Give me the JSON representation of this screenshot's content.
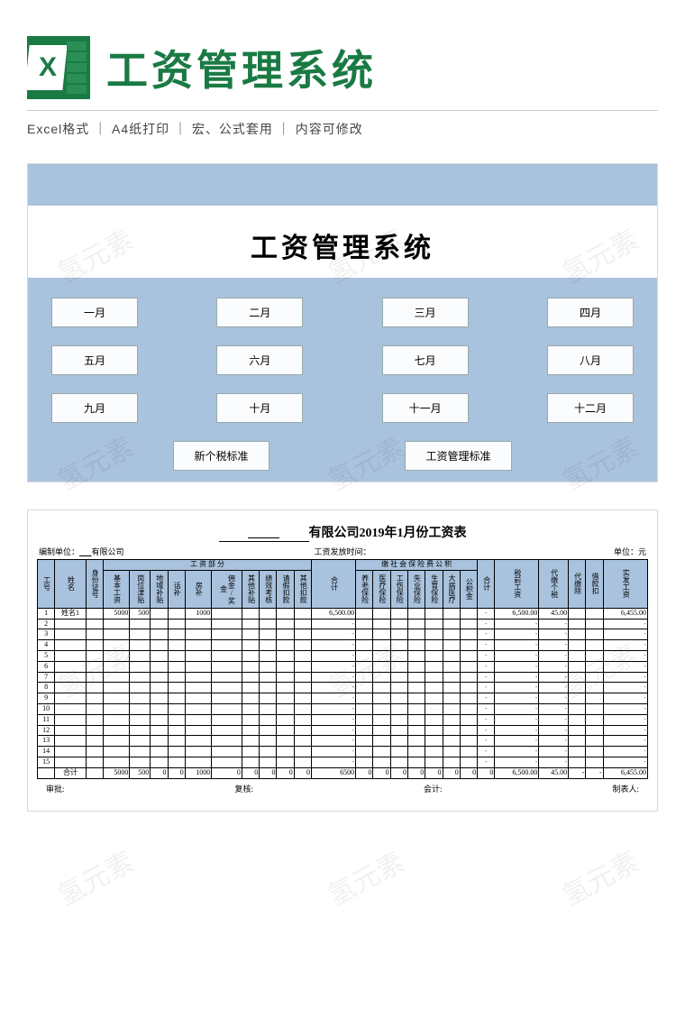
{
  "header": {
    "title": "工资管理系统"
  },
  "meta": "Excel格式 ｜ A4纸打印 ｜ 宏、公式套用 ｜ 内容可修改",
  "panel1": {
    "title": "工资管理系统",
    "months": [
      "一月",
      "二月",
      "三月",
      "四月",
      "五月",
      "六月",
      "七月",
      "八月",
      "九月",
      "十月",
      "十一月",
      "十二月"
    ],
    "std1": "新个税标准",
    "std2": "工资管理标准"
  },
  "panel2": {
    "title_suffix": "有限公司2019年1月份工资表",
    "meta_left_label": "编制单位：",
    "meta_left_value": "有限公司",
    "meta_mid": "工资发放时间：",
    "meta_right": "单位：元",
    "group_salary": "工  资  部  分",
    "group_ins": "缴 社 会 保 险 费 公 积",
    "cols_fixed": [
      "工号",
      "姓名",
      "身份证号"
    ],
    "cols_salary": [
      "基本工资",
      "岗位津贴",
      "地域补贴",
      "话补",
      "房补",
      "佣金/奖金",
      "其他补贴",
      "绩效考核",
      "请假扣款",
      "其他扣款"
    ],
    "col_heji": "合计",
    "cols_ins": [
      "养老保险",
      "医疗保险",
      "工伤保险",
      "失业保险",
      "生育保险",
      "大病医疗",
      "公积金"
    ],
    "cols_tail": [
      "税前工资",
      "代缴个税",
      "代缴除",
      "借款扣",
      "实发工资"
    ],
    "rows": [
      {
        "id": "1",
        "name": "姓名1",
        "v": [
          "5000",
          "500",
          "",
          "",
          "1000",
          "",
          "",
          "",
          "",
          ""
        ],
        "heji": "6,500.00",
        "ins": [
          "",
          "",
          "",
          "",
          "",
          "",
          ""
        ],
        "tail": [
          "6,500.00",
          "45.00",
          "",
          "",
          "6,455.00"
        ]
      },
      {
        "id": "2",
        "name": "",
        "v": [
          "",
          "",
          "",
          "",
          "",
          "",
          "",
          "",
          "",
          ""
        ],
        "heji": "-",
        "ins": [
          "",
          "",
          "",
          "",
          "",
          "",
          ""
        ],
        "tail": [
          "-",
          "-",
          "",
          "",
          "-"
        ]
      },
      {
        "id": "3",
        "name": "",
        "v": [
          "",
          "",
          "",
          "",
          "",
          "",
          "",
          "",
          "",
          ""
        ],
        "heji": "-",
        "ins": [
          "",
          "",
          "",
          "",
          "",
          "",
          ""
        ],
        "tail": [
          "-",
          "-",
          "",
          "",
          "-"
        ]
      },
      {
        "id": "4",
        "name": "",
        "v": [
          "",
          "",
          "",
          "",
          "",
          "",
          "",
          "",
          "",
          ""
        ],
        "heji": "-",
        "ins": [
          "",
          "",
          "",
          "",
          "",
          "",
          ""
        ],
        "tail": [
          "-",
          "-",
          "",
          "",
          "-"
        ]
      },
      {
        "id": "5",
        "name": "",
        "v": [
          "",
          "",
          "",
          "",
          "",
          "",
          "",
          "",
          "",
          ""
        ],
        "heji": "-",
        "ins": [
          "",
          "",
          "",
          "",
          "",
          "",
          ""
        ],
        "tail": [
          "-",
          "-",
          "",
          "",
          "-"
        ]
      },
      {
        "id": "6",
        "name": "",
        "v": [
          "",
          "",
          "",
          "",
          "",
          "",
          "",
          "",
          "",
          ""
        ],
        "heji": "-",
        "ins": [
          "",
          "",
          "",
          "",
          "",
          "",
          ""
        ],
        "tail": [
          "-",
          "-",
          "",
          "",
          "-"
        ]
      },
      {
        "id": "7",
        "name": "",
        "v": [
          "",
          "",
          "",
          "",
          "",
          "",
          "",
          "",
          "",
          ""
        ],
        "heji": "-",
        "ins": [
          "",
          "",
          "",
          "",
          "",
          "",
          ""
        ],
        "tail": [
          "-",
          "-",
          "",
          "",
          "-"
        ]
      },
      {
        "id": "8",
        "name": "",
        "v": [
          "",
          "",
          "",
          "",
          "",
          "",
          "",
          "",
          "",
          ""
        ],
        "heji": "-",
        "ins": [
          "",
          "",
          "",
          "",
          "",
          "",
          ""
        ],
        "tail": [
          "-",
          "-",
          "",
          "",
          "-"
        ]
      },
      {
        "id": "9",
        "name": "",
        "v": [
          "",
          "",
          "",
          "",
          "",
          "",
          "",
          "",
          "",
          ""
        ],
        "heji": "-",
        "ins": [
          "",
          "",
          "",
          "",
          "",
          "",
          ""
        ],
        "tail": [
          "-",
          "-",
          "",
          "",
          "-"
        ]
      },
      {
        "id": "10",
        "name": "",
        "v": [
          "",
          "",
          "",
          "",
          "",
          "",
          "",
          "",
          "",
          ""
        ],
        "heji": "-",
        "ins": [
          "",
          "",
          "",
          "",
          "",
          "",
          ""
        ],
        "tail": [
          "-",
          "-",
          "",
          "",
          "-"
        ]
      },
      {
        "id": "11",
        "name": "",
        "v": [
          "",
          "",
          "",
          "",
          "",
          "",
          "",
          "",
          "",
          ""
        ],
        "heji": "-",
        "ins": [
          "",
          "",
          "",
          "",
          "",
          "",
          ""
        ],
        "tail": [
          "-",
          "-",
          "",
          "",
          "-"
        ]
      },
      {
        "id": "12",
        "name": "",
        "v": [
          "",
          "",
          "",
          "",
          "",
          "",
          "",
          "",
          "",
          ""
        ],
        "heji": "-",
        "ins": [
          "",
          "",
          "",
          "",
          "",
          "",
          ""
        ],
        "tail": [
          "-",
          "-",
          "",
          "",
          "-"
        ]
      },
      {
        "id": "13",
        "name": "",
        "v": [
          "",
          "",
          "",
          "",
          "",
          "",
          "",
          "",
          "",
          ""
        ],
        "heji": "-",
        "ins": [
          "",
          "",
          "",
          "",
          "",
          "",
          ""
        ],
        "tail": [
          "-",
          "-",
          "",
          "",
          "-"
        ]
      },
      {
        "id": "14",
        "name": "",
        "v": [
          "",
          "",
          "",
          "",
          "",
          "",
          "",
          "",
          "",
          ""
        ],
        "heji": "-",
        "ins": [
          "",
          "",
          "",
          "",
          "",
          "",
          ""
        ],
        "tail": [
          "-",
          "-",
          "",
          "",
          "-"
        ]
      },
      {
        "id": "15",
        "name": "",
        "v": [
          "",
          "",
          "",
          "",
          "",
          "",
          "",
          "",
          "",
          ""
        ],
        "heji": "-",
        "ins": [
          "",
          "",
          "",
          "",
          "",
          "",
          ""
        ],
        "tail": [
          "-",
          "-",
          "",
          "",
          "-"
        ]
      }
    ],
    "total_label": "合计",
    "total": {
      "v": [
        "5000",
        "500",
        "0",
        "0",
        "1000",
        "0",
        "0",
        "0",
        "0",
        "0"
      ],
      "heji": "6500",
      "ins": [
        "0",
        "0",
        "0",
        "0",
        "0",
        "0",
        "0"
      ],
      "tail": [
        "6,500.00",
        "45.00",
        "-",
        "-",
        "6,455.00"
      ]
    },
    "foot": [
      "审批:",
      "复核:",
      "会计:",
      "制表人:"
    ]
  },
  "watermark": "氢元素"
}
